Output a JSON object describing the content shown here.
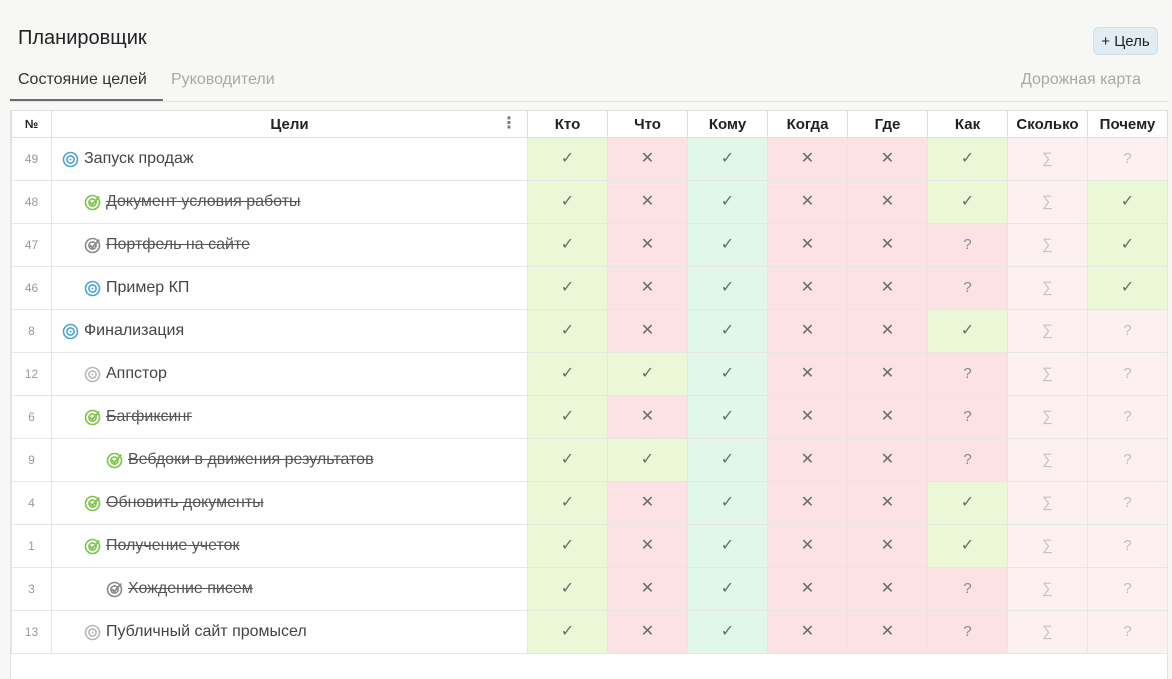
{
  "app": {
    "title": "Планировщик",
    "add_goal_label": "+ Цель"
  },
  "tabs": {
    "active": "Состояние целей",
    "inactive": "Руководители",
    "roadmap": "Дорожная карта"
  },
  "table": {
    "headers": {
      "num": "№",
      "goals": "Цели",
      "who": "Кто",
      "what": "Что",
      "to_whom": "Кому",
      "when": "Когда",
      "where": "Где",
      "how": "Как",
      "how_much": "Сколько",
      "why": "Почему"
    },
    "colors": {
      "green": "#ebf8d7",
      "red": "#fde2e3",
      "mint": "#e0f7ea",
      "pink": "#fdf0f0",
      "icon_blue": "#4aa3d8",
      "icon_green": "#7cc44a",
      "icon_gray": "#b8b8b8"
    },
    "rows": [
      {
        "num": "49",
        "goal": "Запуск продаж",
        "indent": 0,
        "icon": "target-blue",
        "done": false,
        "cells": [
          "check",
          "cross",
          "check",
          "cross",
          "cross",
          "check",
          "sigma",
          "qlight"
        ]
      },
      {
        "num": "48",
        "goal": "Документ условия работы",
        "indent": 1,
        "icon": "target-done-green",
        "done": true,
        "cells": [
          "check",
          "cross",
          "check",
          "cross",
          "cross",
          "check",
          "sigma",
          "check"
        ]
      },
      {
        "num": "47",
        "goal": "Портфель на сайте",
        "indent": 1,
        "icon": "target-done-gray",
        "done": true,
        "cells": [
          "check",
          "cross",
          "check",
          "cross",
          "cross",
          "q",
          "sigma",
          "check"
        ]
      },
      {
        "num": "46",
        "goal": "Пример КП",
        "indent": 1,
        "icon": "target-blue",
        "done": false,
        "cells": [
          "check",
          "cross",
          "check",
          "cross",
          "cross",
          "q",
          "sigma",
          "check"
        ]
      },
      {
        "num": "8",
        "goal": "Финализация",
        "indent": 0,
        "icon": "target-blue",
        "done": false,
        "cells": [
          "check",
          "cross",
          "check",
          "cross",
          "cross",
          "check",
          "sigma",
          "qlight"
        ]
      },
      {
        "num": "12",
        "goal": "Аппстор",
        "indent": 1,
        "icon": "target-gray",
        "done": false,
        "cells": [
          "check",
          "check",
          "check",
          "cross",
          "cross",
          "q",
          "sigma",
          "qlight"
        ]
      },
      {
        "num": "6",
        "goal": "Багфиксинг",
        "indent": 1,
        "icon": "target-done-green",
        "done": true,
        "cells": [
          "check",
          "cross",
          "check",
          "cross",
          "cross",
          "q",
          "sigma",
          "qlight"
        ]
      },
      {
        "num": "9",
        "goal": "Вебдоки в движения результатов",
        "indent": 2,
        "icon": "target-done-green",
        "done": true,
        "cells": [
          "check",
          "check",
          "check",
          "cross",
          "cross",
          "q",
          "sigma",
          "qlight"
        ]
      },
      {
        "num": "4",
        "goal": "Обновить документы",
        "indent": 1,
        "icon": "target-done-green",
        "done": true,
        "cells": [
          "check",
          "cross",
          "check",
          "cross",
          "cross",
          "check",
          "sigma",
          "qlight"
        ]
      },
      {
        "num": "1",
        "goal": "Получение учеток",
        "indent": 1,
        "icon": "target-done-green",
        "done": true,
        "cells": [
          "check",
          "cross",
          "check",
          "cross",
          "cross",
          "check",
          "sigma",
          "qlight"
        ]
      },
      {
        "num": "3",
        "goal": "Хождение писем",
        "indent": 2,
        "icon": "target-done-gray",
        "done": true,
        "cells": [
          "check",
          "cross",
          "check",
          "cross",
          "cross",
          "q",
          "sigma",
          "qlight"
        ]
      },
      {
        "num": "13",
        "goal": "Публичный сайт промысел",
        "indent": 1,
        "icon": "target-gray",
        "done": false,
        "cells": [
          "check",
          "cross",
          "check",
          "cross",
          "cross",
          "q",
          "sigma",
          "qlight"
        ]
      }
    ]
  }
}
